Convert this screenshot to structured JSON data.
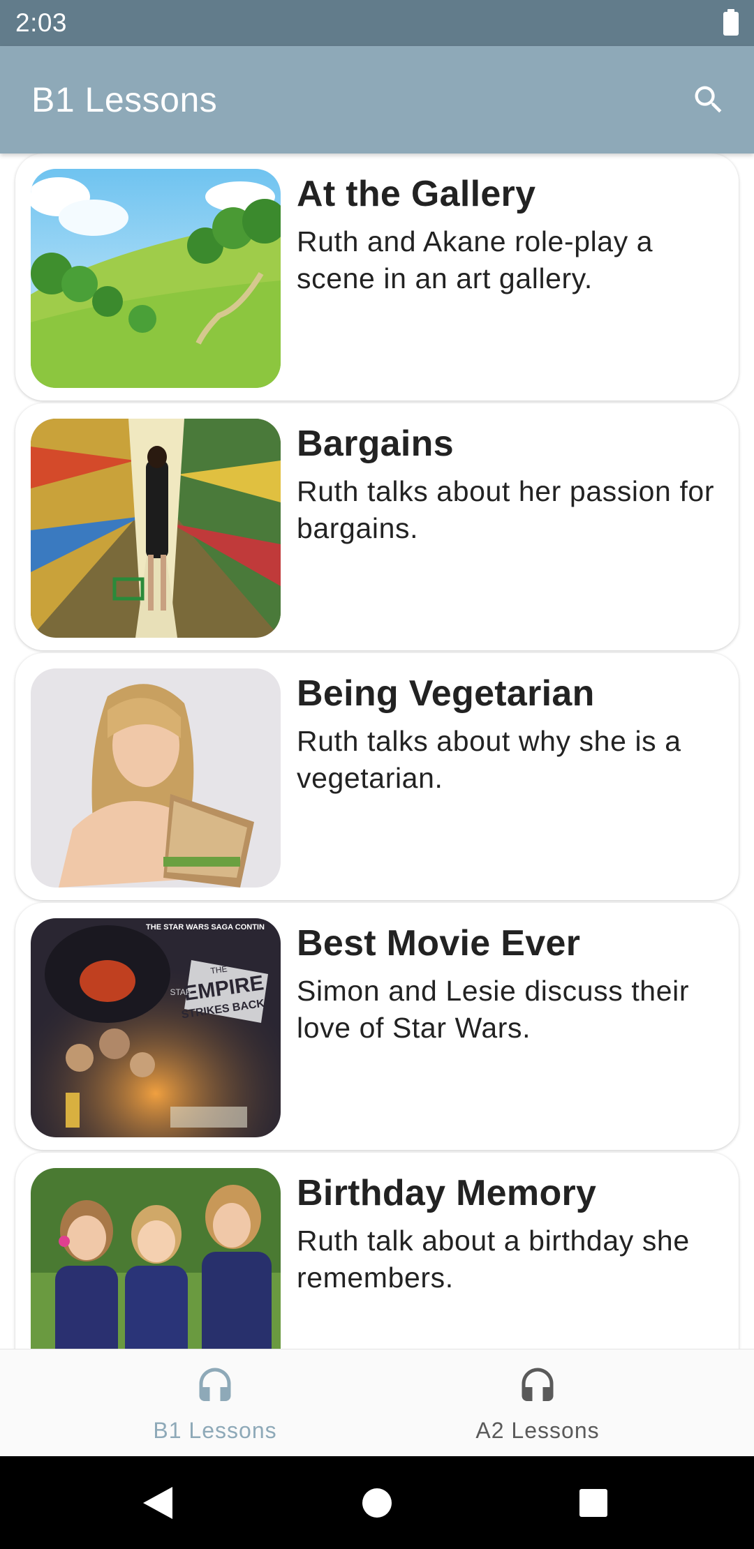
{
  "status_bar": {
    "time": "2:03"
  },
  "app_bar": {
    "title": "B1 Lessons",
    "search_icon": "search-icon"
  },
  "lessons": [
    {
      "title": "At the Gallery",
      "description": "Ruth and Akane role-play a scene in an art gallery.",
      "image": "landscape-hills"
    },
    {
      "title": "Bargains",
      "description": "Ruth talks about her passion for bargains.",
      "image": "supermarket-aisle"
    },
    {
      "title": "Being Vegetarian",
      "description": "Ruth talks about why she is a vegetarian.",
      "image": "girl-eating-sandwich"
    },
    {
      "title": "Best Movie Ever",
      "description": "Simon and Lesie discuss their love of Star Wars.",
      "image": "star-wars-poster"
    },
    {
      "title": "Birthday Memory",
      "description": "Ruth talk about a birthday she remembers.",
      "image": "girls-laughing"
    }
  ],
  "poster_text": {
    "top": "THE STAR WARS SAGA CONTIN",
    "line1": "EMPIRE",
    "line2": "STRIKES BACK",
    "small": "STAR",
    "the": "THE"
  },
  "bottom_nav": {
    "items": [
      {
        "label": "B1 Lessons",
        "icon": "headphones-icon",
        "active": true
      },
      {
        "label": "A2 Lessons",
        "icon": "headphones-icon",
        "active": false
      }
    ]
  },
  "colors": {
    "accent": "#8ea9b8",
    "status_bar": "#627c8b",
    "inactive": "#5a5a5a"
  }
}
